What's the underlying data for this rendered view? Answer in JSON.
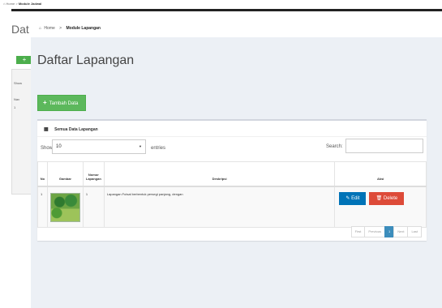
{
  "bg": {
    "crumb_home": "Home",
    "crumb_sep": ">",
    "crumb_current": "Module Jadwal",
    "title": "Dat",
    "add_symbol": "+",
    "small1": "Show",
    "small2": "Nav",
    "small3": "1"
  },
  "breadcrumb": {
    "home": "Home",
    "sep": ">",
    "current": "Module Lapangan"
  },
  "page": {
    "title": "Daftar Lapangan"
  },
  "buttons": {
    "tambah_icon": "+",
    "tambah": "Tambah Data"
  },
  "box": {
    "title": "Semua Data Lapangan",
    "grid_icon": "▦"
  },
  "controls": {
    "show_label": "Show",
    "show_value": "10",
    "caret": "▼",
    "entries_label": "entries",
    "search_label": "Search:"
  },
  "table": {
    "headers": [
      "No",
      "Gambar",
      "Nomor Lapangan",
      "Deskripsi",
      "Aksi"
    ],
    "rows": [
      {
        "no": "1",
        "nomor": "1",
        "deskripsi": "Lapangan Futsal berbentuk persegi panjang, dengan",
        "edit": "Edit",
        "delete": "Delete"
      }
    ]
  },
  "pagination": {
    "first": "First",
    "previous": "Previous",
    "current": "1",
    "next": "Next",
    "last": "Last"
  },
  "colors": {
    "success": "#5cb85c",
    "primary": "#0073b7",
    "danger": "#dd4b39",
    "active_page": "#3c8dbc"
  }
}
